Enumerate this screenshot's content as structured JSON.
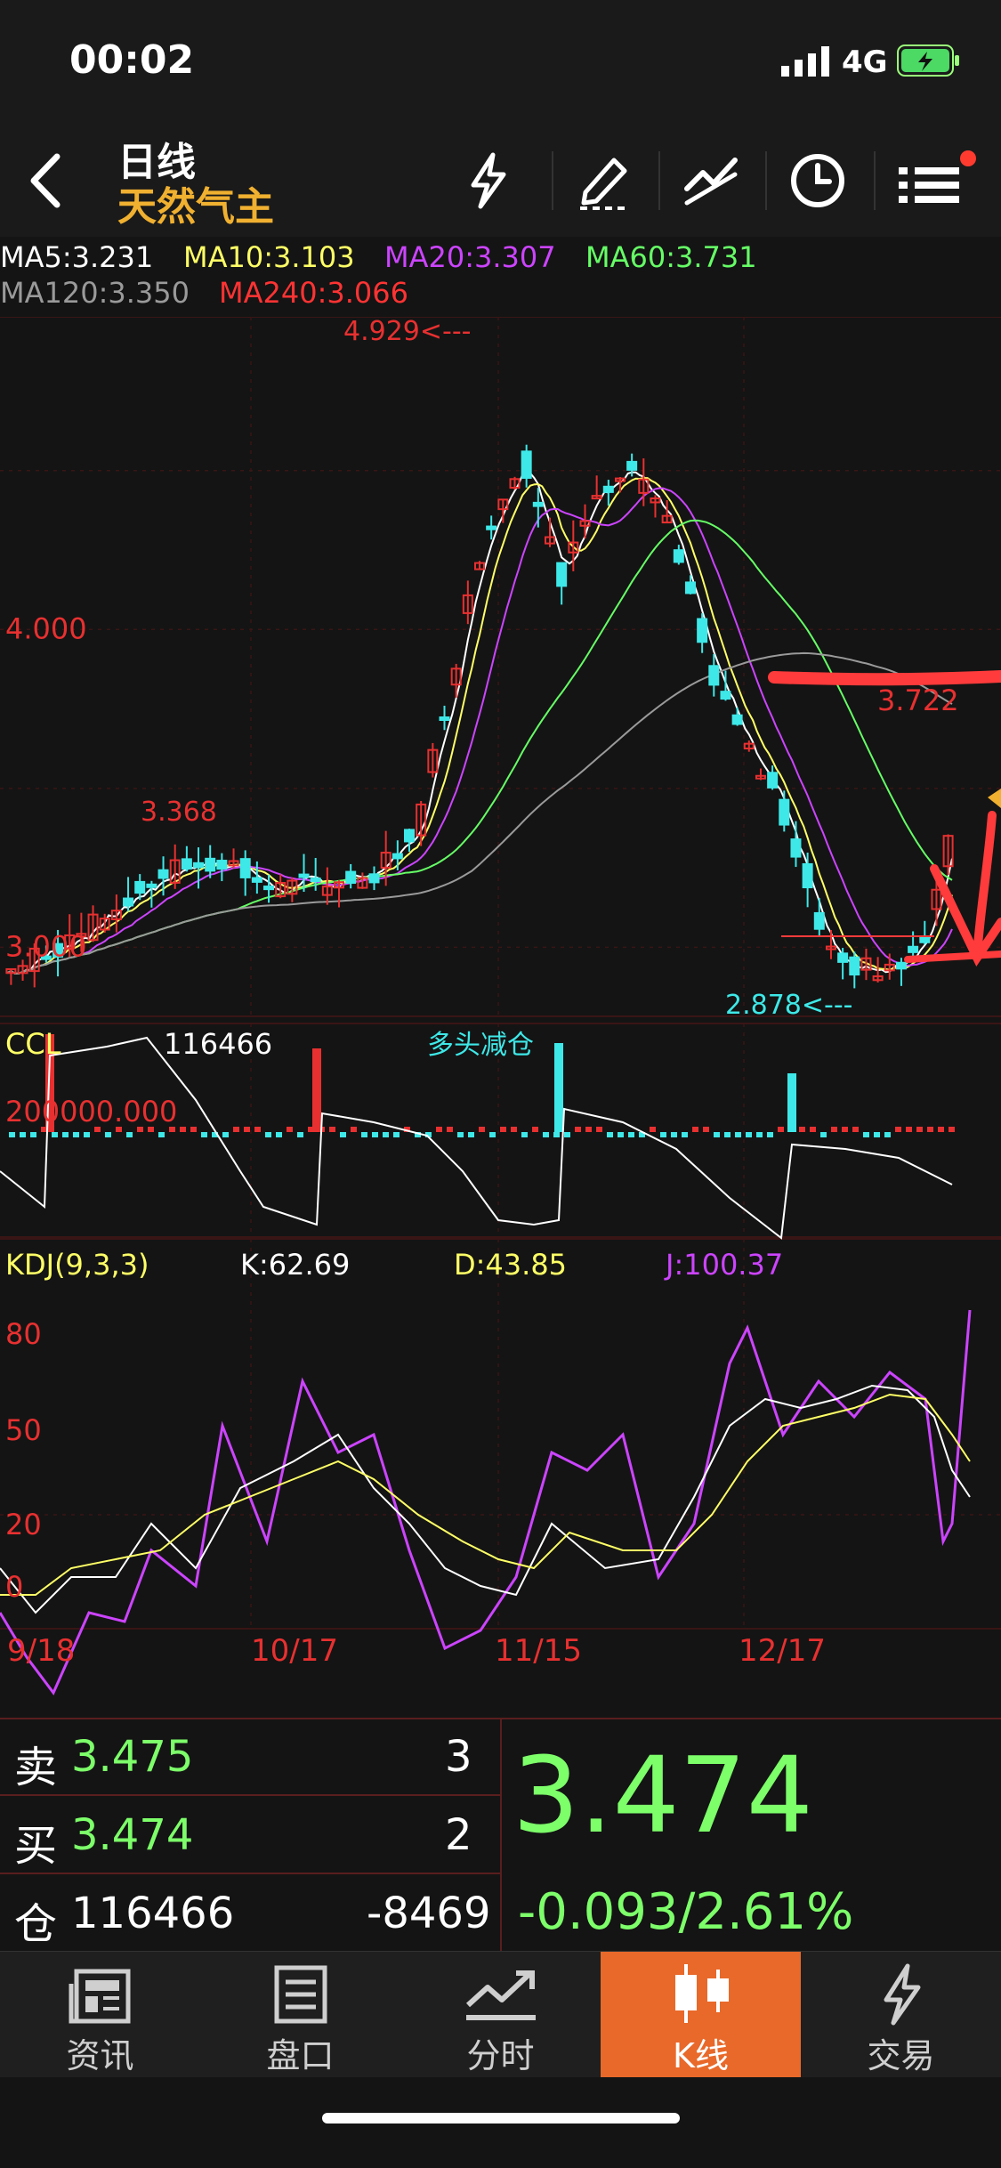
{
  "status_bar": {
    "time": "00:02",
    "network": "4G"
  },
  "header": {
    "back_icon": "chevron-left-icon",
    "period": "日线",
    "instrument": "天然气主",
    "toolbar_icons": [
      "lightning-icon",
      "draw-pen-icon",
      "trend-line-icon",
      "clock-icon",
      "menu-icon"
    ],
    "menu_badge": true
  },
  "ma_legend": [
    {
      "label": "MA5:3.231",
      "color": "#ffffff"
    },
    {
      "label": "MA10:3.103",
      "color": "#ffff66"
    },
    {
      "label": "MA20:3.307",
      "color": "#cc44ff"
    },
    {
      "label": "MA60:3.731",
      "color": "#66ff66"
    },
    {
      "label": "MA120:3.350",
      "color": "#9a9a9a"
    },
    {
      "label": "MA240:3.066",
      "color": "#ff3333"
    }
  ],
  "chart_data": [
    {
      "type": "candlestick",
      "price_labels": {
        "axis_4000": "4.000",
        "axis_3000": "3.000",
        "high": "4.929<---",
        "low": "2.878<---",
        "local_high": "3.368",
        "right": "3.722"
      },
      "ylim": [
        2.85,
        4.95
      ],
      "grid": true
    },
    {
      "type": "bar",
      "title": "CCL",
      "value": "116466",
      "annotation": "多头减仓",
      "axis_label": "200000.000"
    },
    {
      "type": "line",
      "title": "KDJ(9,3,3)",
      "k": "K:62.69",
      "d": "D:43.85",
      "j": "J:100.37",
      "y_ticks": [
        "80",
        "50",
        "20",
        "0"
      ]
    }
  ],
  "x_axis_dates": [
    "9/18",
    "10/17",
    "11/15",
    "12/17"
  ],
  "quote": {
    "sell_label": "卖",
    "sell_price": "3.475",
    "sell_qty": "3",
    "buy_label": "买",
    "buy_price": "3.474",
    "buy_qty": "2",
    "oi_label": "仓",
    "oi_value": "116466",
    "oi_change": "-8469",
    "last_price": "3.474",
    "change": "-0.093/2.61%"
  },
  "tabs": [
    {
      "label": "资讯",
      "icon": "news-icon",
      "active": false
    },
    {
      "label": "盘口",
      "icon": "orderbook-icon",
      "active": false
    },
    {
      "label": "分时",
      "icon": "timeshare-icon",
      "active": false
    },
    {
      "label": "K线",
      "icon": "candlestick-icon",
      "active": true
    },
    {
      "label": "交易",
      "icon": "trade-lightning-icon",
      "active": false
    }
  ],
  "colors": {
    "up": "#e83030",
    "down": "#3ee8e8",
    "accent": "#e8692a",
    "price_green": "#7dff6a",
    "gold": "#f0b030"
  }
}
